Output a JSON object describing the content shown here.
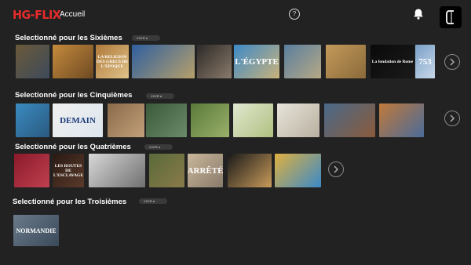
{
  "header": {
    "logo_text": "HG-FLIX",
    "nav_home": "Accueil",
    "help_icon_glyph": "?",
    "bell_icon": "bell-icon",
    "profile_icon": "channel-c-icon",
    "brand_color": "#e52b2b"
  },
  "rows": [
    {
      "title": "Selectionné pour les Sixièmes",
      "voir": "VOIR ▸",
      "thumbs": [
        {
          "colors": [
            "#6b5a3a",
            "#3d4a5a"
          ],
          "caption": ""
        },
        {
          "colors": [
            "#c58a3d",
            "#6e4a22"
          ],
          "caption": ""
        },
        {
          "colors": [
            "#b07a3a",
            "#e0c28a"
          ],
          "caption": "LA RELIGION DES GRECS DE L'ÉPOQUE"
        },
        {
          "colors": [
            "#2f5fa0",
            "#b6a06a"
          ],
          "caption": ""
        },
        {
          "colors": [
            "#2d2a28",
            "#8a7a6a"
          ],
          "caption": ""
        },
        {
          "colors": [
            "#3d8ac8",
            "#c9b27a"
          ],
          "caption": "L'ÉGYPTE"
        },
        {
          "colors": [
            "#5a7f9e",
            "#b6a886"
          ],
          "caption": ""
        },
        {
          "colors": [
            "#c49a5a",
            "#8a6a3a"
          ],
          "caption": ""
        },
        {
          "colors": [
            "#0a0a0a",
            "#1a1a1a"
          ],
          "caption": "La fondation de Rome"
        },
        {
          "colors": [
            "#7aa0c8",
            "#c8d8e8"
          ],
          "caption": "753"
        }
      ],
      "arrow_icon": "chevron-right-icon"
    },
    {
      "title": "Selectionné pour les Cinquièmes",
      "voir": "VOIR ▸",
      "thumbs": [
        {
          "colors": [
            "#3a8ac0",
            "#2a5a80"
          ],
          "caption": ""
        },
        {
          "colors": [
            "#f0f0f0",
            "#dde6ee"
          ],
          "caption": "DEMAIN"
        },
        {
          "colors": [
            "#8a6a4a",
            "#c2a07a"
          ],
          "caption": ""
        },
        {
          "colors": [
            "#3a5a3a",
            "#6a8a6a"
          ],
          "caption": ""
        },
        {
          "colors": [
            "#5a7a3a",
            "#9ab06a"
          ],
          "caption": ""
        },
        {
          "colors": [
            "#e0e8d0",
            "#b0c080"
          ],
          "caption": ""
        },
        {
          "colors": [
            "#e8e4da",
            "#b8b0a0"
          ],
          "caption": ""
        },
        {
          "colors": [
            "#4a6a8a",
            "#8a5a3a"
          ],
          "caption": ""
        },
        {
          "colors": [
            "#c07a3a",
            "#4a6a9a"
          ],
          "caption": ""
        },
        {
          "colors": [
            "#3a4a5a",
            "#6a7a8a"
          ],
          "caption": ""
        }
      ],
      "arrow_icon": "chevron-right-icon"
    },
    {
      "title": "Selectionné pour les Quatrièmes",
      "voir": "VOIR ▸",
      "thumbs": [
        {
          "colors": [
            "#8a1a2a",
            "#c04050"
          ],
          "caption": ""
        },
        {
          "colors": [
            "#2a1a14",
            "#5a3a2a"
          ],
          "caption": "LES ROUTES DE L'ESCLAVAGE"
        },
        {
          "colors": [
            "#d8d8d8",
            "#707070"
          ],
          "caption": ""
        },
        {
          "colors": [
            "#5a6a3a",
            "#8a7a4a"
          ],
          "caption": ""
        },
        {
          "colors": [
            "#c9b79a",
            "#8a7a6a"
          ],
          "caption": "ARRÊTÉ"
        },
        {
          "colors": [
            "#1a1a1a",
            "#c89a5a"
          ],
          "caption": ""
        },
        {
          "colors": [
            "#e0b040",
            "#3a8ac8"
          ],
          "caption": ""
        }
      ],
      "arrow_icon": "chevron-right-icon"
    },
    {
      "title": "Selectionné pour les Troisièmes",
      "voir": "VOIR ▸",
      "thumbs": [
        {
          "colors": [
            "#6a7a8a",
            "#3a4a5a"
          ],
          "caption": "NORMANDIE"
        }
      ]
    }
  ]
}
